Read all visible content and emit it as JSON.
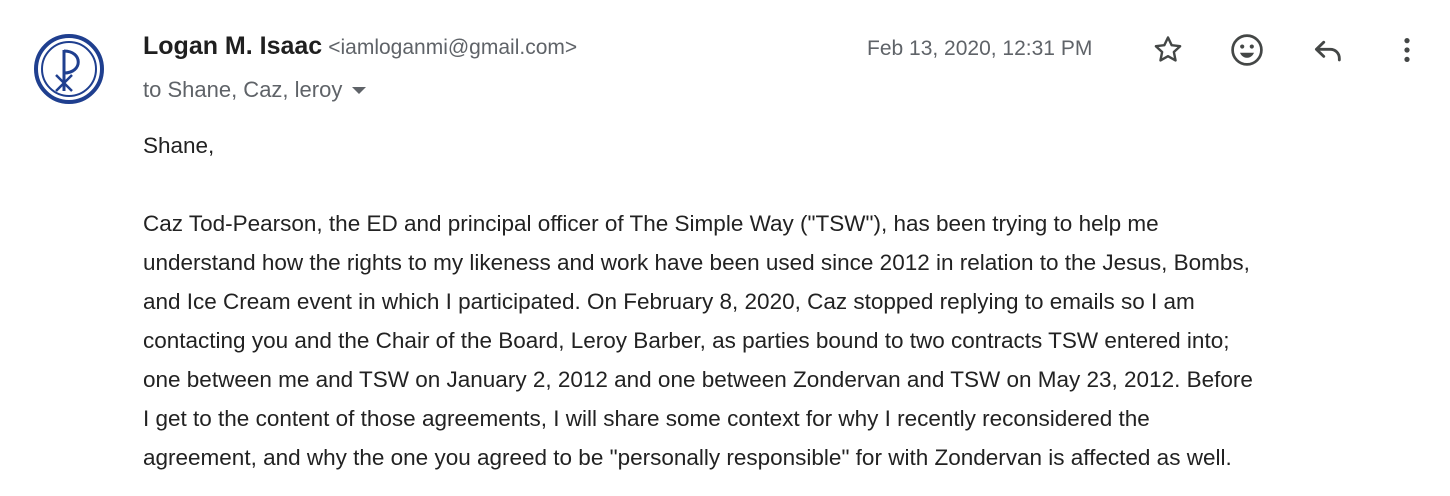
{
  "sender": {
    "name": "Logan M. Isaac",
    "email": "<iamloganmi@gmail.com>"
  },
  "timestamp": "Feb 13, 2020, 12:31 PM",
  "recipients": "to Shane, Caz, leroy",
  "actions": {
    "star_icon": "star-icon",
    "emoji_icon": "emoji-icon",
    "reply_icon": "reply-icon",
    "more_icon": "more-vertical-icon"
  },
  "message": {
    "greeting": "Shane,",
    "lines": [
      "Caz Tod-Pearson, the ED and principal officer of The Simple Way (\"TSW\"), has been trying to help me",
      "understand how the rights to my likeness and work have been used since 2012 in relation to the Jesus, Bombs,",
      "and Ice Cream event in which I participated. On February 8, 2020, Caz stopped replying to emails so I am",
      "contacting you and the Chair of the Board, Leroy Barber, as parties bound to two contracts TSW entered into;",
      "one between me and TSW on January 2, 2012 and one between Zondervan and TSW on May 23, 2012. Before",
      "I get to the content of those agreements, I will share some context for why I recently reconsidered the",
      "agreement, and why the one you agreed to be \"personally responsible\" for with Zondervan is affected as well."
    ]
  },
  "colors": {
    "avatar_blue": "#1f3f8f",
    "secondary_text": "#5f6368",
    "icon": "#444746"
  }
}
